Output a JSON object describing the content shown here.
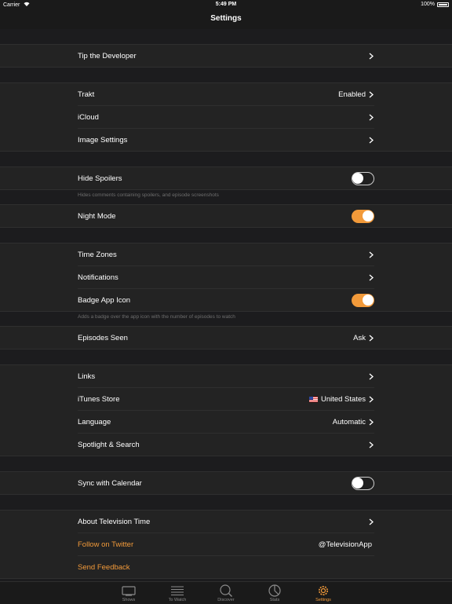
{
  "status_bar": {
    "carrier": "Carrier",
    "time": "5:49 PM",
    "battery": "100%"
  },
  "nav": {
    "title": "Settings"
  },
  "sections": {
    "tip": {
      "label": "Tip the Developer"
    },
    "trakt": {
      "label": "Trakt",
      "value": "Enabled"
    },
    "icloud": {
      "label": "iCloud"
    },
    "image_settings": {
      "label": "Image Settings"
    },
    "hide_spoilers": {
      "label": "Hide Spoilers",
      "on": false,
      "note": "Hides comments containing spoilers, and episode screenshots"
    },
    "night_mode": {
      "label": "Night Mode",
      "on": true
    },
    "time_zones": {
      "label": "Time Zones"
    },
    "notifications": {
      "label": "Notifications"
    },
    "badge_app_icon": {
      "label": "Badge App Icon",
      "on": true,
      "note": "Adds a badge over the app icon with the number of episodes to watch"
    },
    "episodes_seen": {
      "label": "Episodes Seen",
      "value": "Ask"
    },
    "links": {
      "label": "Links"
    },
    "itunes_store": {
      "label": "iTunes Store",
      "value": "United States"
    },
    "language": {
      "label": "Language",
      "value": "Automatic"
    },
    "spotlight": {
      "label": "Spotlight & Search"
    },
    "sync_calendar": {
      "label": "Sync with Calendar",
      "on": false
    },
    "about": {
      "label": "About Television Time"
    },
    "twitter": {
      "label": "Follow on Twitter",
      "value": "@TelevisionApp"
    },
    "feedback": {
      "label": "Send Feedback"
    }
  },
  "tabs": [
    {
      "label": "Shows",
      "icon": "tv-icon"
    },
    {
      "label": "To Watch",
      "icon": "list-icon"
    },
    {
      "label": "Discover",
      "icon": "search-icon"
    },
    {
      "label": "Stats",
      "icon": "pie-chart-icon"
    },
    {
      "label": "Settings",
      "icon": "gear-icon",
      "active": true
    }
  ],
  "colors": {
    "accent": "#f29a3a",
    "background": "#1c1c1e",
    "cell": "#232323"
  }
}
